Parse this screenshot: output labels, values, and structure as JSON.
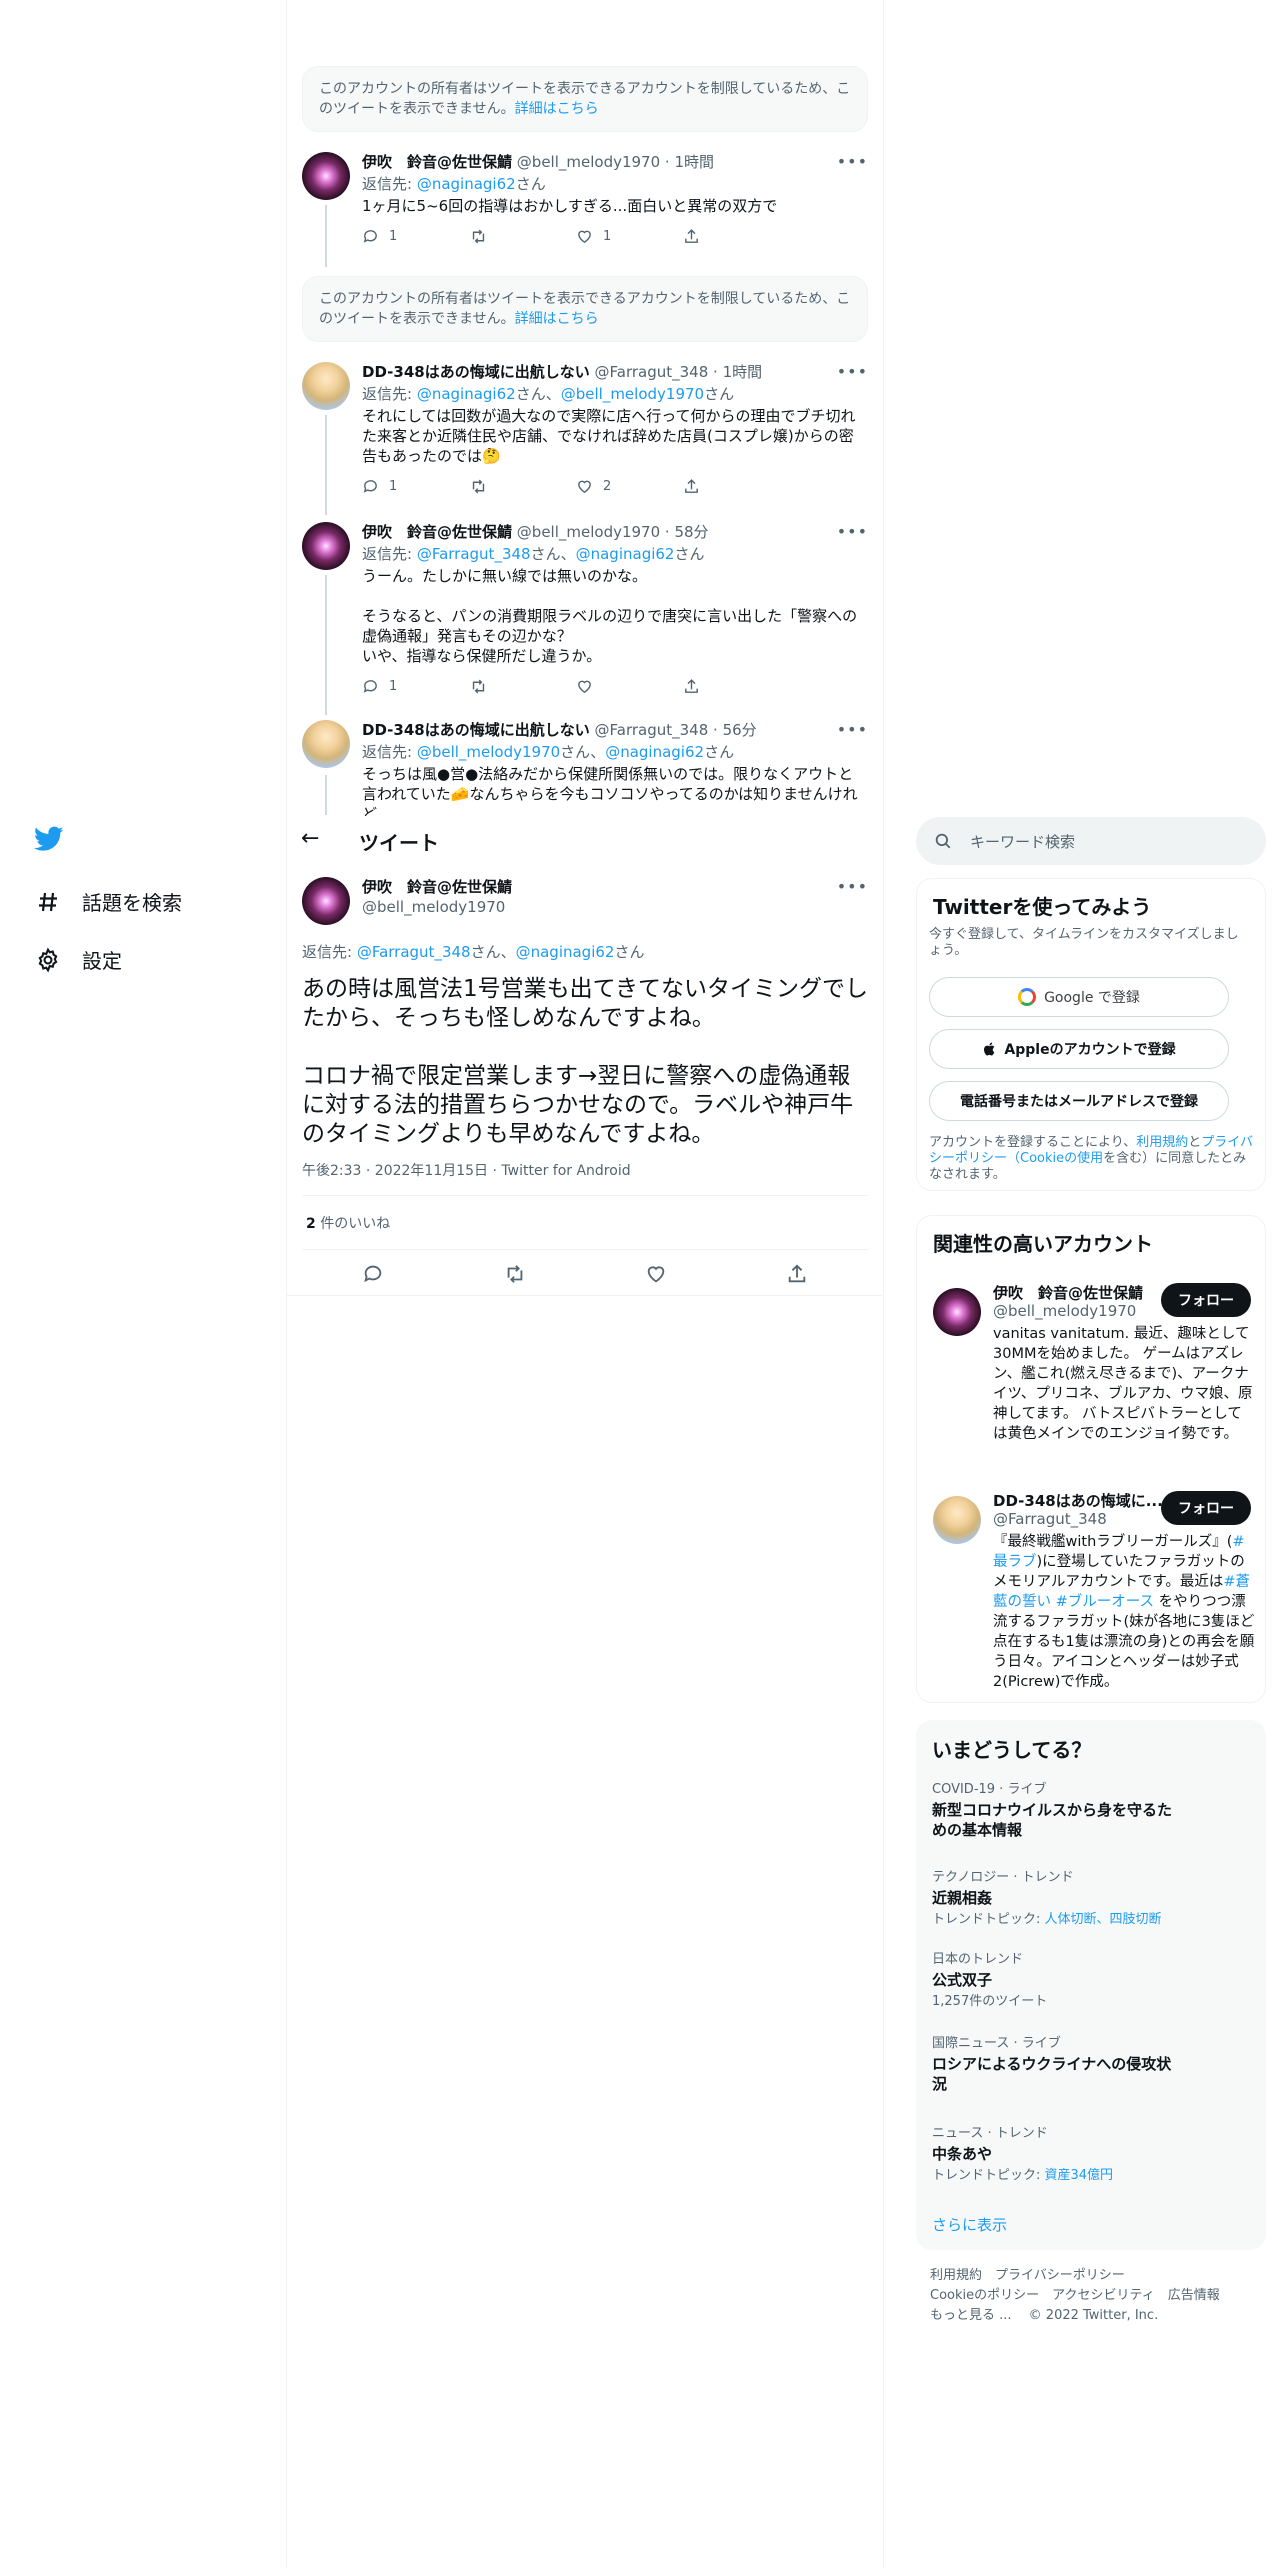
{
  "nav": {
    "explore_label": "話題を検索",
    "settings_label": "設定"
  },
  "notice": {
    "text": "このアカウントの所有者はツイートを表示できるアカウントを制限しているため、このツイートを表示できません。",
    "link": "詳細はこちら"
  },
  "thread": [
    {
      "name": "伊吹　鈴音@佐世保鯖",
      "handle": "@bell_melody1970",
      "time": "· 1時間",
      "reply_prefix": "返信先: ",
      "reply_to": [
        "@naginagi62"
      ],
      "reply_suffix": "さん",
      "text": "1ヶ月に5~6回の指導はおかしすぎる...面白いと異常の双方で",
      "replies": "1",
      "retweets": "",
      "likes": "1"
    },
    {
      "name": "DD-348はあの悔域に出航しない",
      "handle": "@Farragut_348",
      "time": "· 1時間",
      "reply_prefix": "返信先: ",
      "reply_to": [
        "@naginagi62",
        "@bell_melody1970"
      ],
      "reply_suffix": "さん",
      "text": "それにしては回数が過大なので実際に店へ行って何からの理由でブチ切れた来客とか近隣住民や店舗、でなければ辞めた店員(コスプレ嬢)からの密告もあったのでは🤔",
      "replies": "1",
      "retweets": "",
      "likes": "2"
    },
    {
      "name": "伊吹　鈴音@佐世保鯖",
      "handle": "@bell_melody1970",
      "time": "· 58分",
      "reply_prefix": "返信先: ",
      "reply_to": [
        "@Farragut_348",
        "@naginagi62"
      ],
      "reply_suffix": "さん",
      "text": "うーん。たしかに無い線では無いのかな。\n\nそうなると、パンの消費期限ラベルの辺りで唐突に言い出した「警察への虚偽通報」発言もその辺かな？\nいや、指導なら保健所だし違うか。",
      "replies": "1",
      "retweets": "",
      "likes": ""
    },
    {
      "name": "DD-348はあの悔域に出航しない",
      "handle": "@Farragut_348",
      "time": "· 56分",
      "reply_prefix": "返信先: ",
      "reply_to": [
        "@bell_melody1970",
        "@naginagi62"
      ],
      "reply_suffix": "さん",
      "text": "そっちは風●営●法絡みだから保健所関係無いのでは。限りなくアウトと言われていた🧀なんちゃらを今もコソコソやってるのかは知りませんけれど"
    }
  ],
  "header": {
    "back": "←",
    "title": "ツイート"
  },
  "main_tweet": {
    "name": "伊吹　鈴音@佐世保鯖",
    "handle": "@bell_melody1970",
    "reply_prefix": "返信先: ",
    "reply_to_1": "@Farragut_348",
    "reply_mid": "さん、",
    "reply_to_2": "@naginagi62",
    "reply_suffix": "さん",
    "text": "あの時は風営法1号営業も出てきてないタイミングでしたから、そっちも怪しめなんですよね。\n\nコロナ禍で限定営業します→翌日に警察への虚偽通報に対する法的措置ちらつかせなので。ラベルや神戸牛のタイミングよりも早めなんですよね。",
    "timestamp": "午後2:33 · 2022年11月15日 · Twitter for Android",
    "likes_count": "2",
    "likes_label": " 件のいいね"
  },
  "search": {
    "placeholder": "キーワード検索"
  },
  "signup": {
    "title": "Twitterを使ってみよう",
    "subtitle": "今すぐ登録して、タイムラインをカスタマイズしましょう。",
    "google": "Google で登録",
    "apple": "Appleのアカウントで登録",
    "phone": "電話番号またはメールアドレスで登録",
    "terms_1": "アカウントを登録することにより、",
    "terms_link_1": "利用規約",
    "terms_2": "と",
    "terms_link_2": "プライバシーポリシー（Cookieの使用",
    "terms_3": "を含む）に同意したとみなされます。"
  },
  "related": {
    "title": "関連性の高いアカウント",
    "follow": "フォロー",
    "accounts": [
      {
        "name": "伊吹　鈴音@佐世保鯖",
        "handle": "@bell_melody1970",
        "bio": "vanitas vanitatum. 最近、趣味として30MMを始めました。 ゲームはアズレン、艦これ(燃え尽きるまで)、アークナイツ、プリコネ、ブルアカ、ウマ娘、原神してます。 バトスピバトラーとしては黄色メインでのエンジョイ勢です。"
      },
      {
        "name": "DD-348はあの悔域に...",
        "handle": "@Farragut_348",
        "bio_1": "『最終戦艦withラブリーガールズ』(",
        "bio_link_1": "#最ラブ",
        "bio_2": ")に登場していたファラガットのメモリアルアカウントです。最近は",
        "bio_link_2": "#蒼藍の誓い",
        "bio_link_3": "#ブルーオース",
        "bio_3": " をやりつつ漂流するファラガット(妹が各地に3隻ほど点在するも1隻は漂流の身)との再会を願う日々。アイコンとヘッダーは妙子式2(Picrew)で作成。"
      }
    ]
  },
  "trends": {
    "title": "いまどうしてる？",
    "items": [
      {
        "meta": "COVID-19 · ライブ",
        "title": "新型コロナウイルスから身を守るための基本情報",
        "sub_label": "",
        "sub_links": ""
      },
      {
        "meta": "テクノロジー · トレンド",
        "title": "近親相姦",
        "sub_label": "トレンドトピック: ",
        "sub_links": "人体切断、四肢切断"
      },
      {
        "meta": "日本のトレンド",
        "title": "公式双子",
        "sub_label": "1,257件のツイート",
        "sub_links": ""
      },
      {
        "meta": "国際ニュース · ライブ",
        "title": "ロシアによるウクライナへの侵攻状況",
        "sub_label": "",
        "sub_links": ""
      },
      {
        "meta": "ニュース · トレンド",
        "title": "中条あや",
        "sub_label": "トレンドトピック: ",
        "sub_links": "資産34億円"
      }
    ],
    "more": "さらに表示"
  },
  "footer": {
    "line1": "利用規約　プライバシーポリシー",
    "line2": "Cookieのポリシー　アクセシビリティ　広告情報",
    "line3": "もっと見る ...　 © 2022 Twitter, Inc."
  }
}
